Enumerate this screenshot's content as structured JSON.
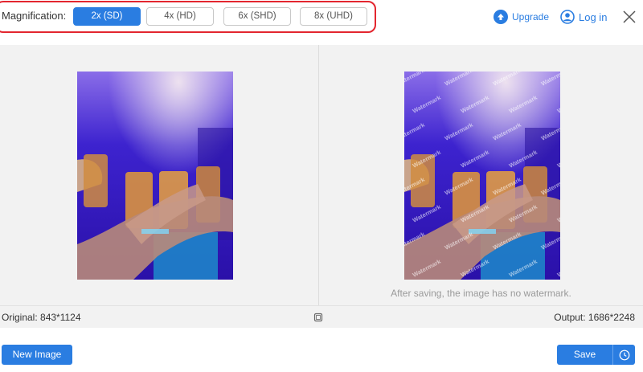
{
  "topbar": {
    "magnification_label": "Magnification:",
    "options": [
      {
        "label": "2x (SD)",
        "active": true
      },
      {
        "label": "4x (HD)",
        "active": false
      },
      {
        "label": "6x (SHD)",
        "active": false
      },
      {
        "label": "8x (UHD)",
        "active": false
      }
    ],
    "upgrade_label": "Upgrade",
    "login_label": "Log in",
    "accent_color": "#2a7de1",
    "highlight_color": "#e3262f"
  },
  "preview": {
    "watermark_text": "Watermark",
    "watermark_note": "After saving, the image has no watermark."
  },
  "infobar": {
    "original": "Original: 843*1124",
    "output": "Output: 1686*2248"
  },
  "actions": {
    "new_image_label": "New Image",
    "save_label": "Save"
  }
}
